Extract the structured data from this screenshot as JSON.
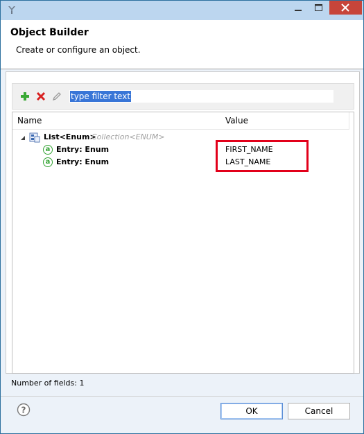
{
  "dialog": {
    "title": "Object Builder",
    "description": "Create or configure an object."
  },
  "toolbar": {
    "add_icon": "add-icon",
    "remove_icon": "remove-icon",
    "edit_icon": "edit-icon",
    "filter_placeholder": "type filter text",
    "filter_value": "type filter text"
  },
  "table": {
    "columns": [
      "Name",
      "Value"
    ],
    "root": {
      "name": "List<Enum>",
      "type": "Collection<ENUM>",
      "expanded": true,
      "children": [
        {
          "name": "Entry: Enum",
          "value": "FIRST_NAME"
        },
        {
          "name": "Entry: Enum",
          "value": "LAST_NAME"
        }
      ]
    }
  },
  "status": "Number of fields: 1",
  "buttons": {
    "ok": "OK",
    "cancel": "Cancel"
  },
  "colors": {
    "highlight": "#e2001a",
    "titlebar": "#bcd6ef",
    "close": "#c7453a",
    "selection": "#3875d7"
  }
}
